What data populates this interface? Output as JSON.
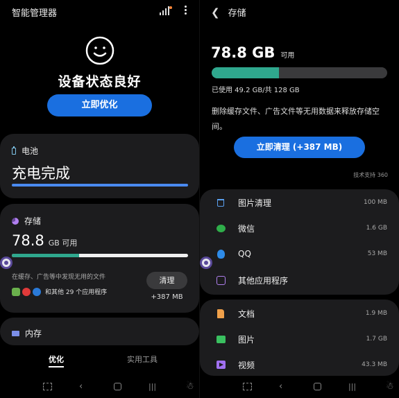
{
  "left": {
    "app_title": "智能管理器",
    "status_title": "设备状态良好",
    "optimize_button": "立即优化",
    "battery": {
      "label": "电池",
      "status": "充电完成"
    },
    "storage": {
      "label": "存储",
      "available_value": "78.8",
      "available_unit": "GB 可用",
      "used_fraction": 0.38,
      "note": "在缓存、广告等中发现无用的文件",
      "apps_text": "和其他 29 个应用程序",
      "clean_button": "清理",
      "clean_size": "+387 MB"
    },
    "memory": {
      "label": "内存"
    },
    "tabs": [
      "优化",
      "实用工具"
    ]
  },
  "right": {
    "header_title": "存储",
    "available_value": "78.8 GB",
    "available_unit": "可用",
    "used_fraction": 0.384,
    "used_text": "已使用 49.2 GB/共 128 GB",
    "description": "删除缓存文件、广告文件等无用数据来释放存储空间。",
    "clean_button": "立即清理 (+387 MB)",
    "powered_by": "技术支持 360",
    "junk_items": [
      {
        "label": "图片清理",
        "size": "100 MB",
        "icon": "trash-icon"
      },
      {
        "label": "微信",
        "size": "1.6 GB",
        "icon": "wechat-icon"
      },
      {
        "label": "QQ",
        "size": "53 MB",
        "icon": "qq-icon"
      },
      {
        "label": "其他应用程序",
        "size": "",
        "icon": "apps-grid-icon"
      }
    ],
    "file_items": [
      {
        "label": "文档",
        "size": "1.9 MB",
        "icon": "document-icon"
      },
      {
        "label": "图片",
        "size": "1.7 GB",
        "icon": "image-icon"
      },
      {
        "label": "视频",
        "size": "43.3 MB",
        "icon": "video-icon"
      }
    ]
  },
  "colors": {
    "accent_blue": "#1a6fe0",
    "storage_green": "#2fa88e",
    "card_bg": "#1c1c1e"
  }
}
